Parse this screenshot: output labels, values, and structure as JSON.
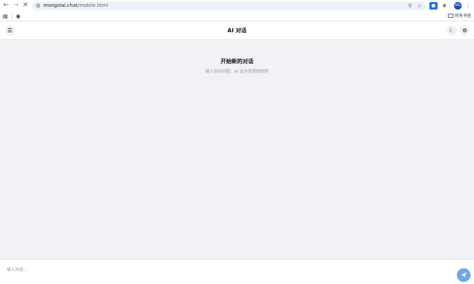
{
  "browser": {
    "url_host": "mongolai.chat",
    "url_path": "/mobile.html",
    "profile_initials": "MG",
    "bookmarks_all_label": "所有书签",
    "icons": [
      "back-icon",
      "forward-icon",
      "stop-icon",
      "site-info-icon",
      "zoom-icon",
      "bookmark-star-icon",
      "extensions-icon",
      "kebab-menu-icon",
      "apps-icon",
      "globe-icon",
      "folder-icon"
    ]
  },
  "header": {
    "title": "AI 对话",
    "icons": [
      "hamburger-menu-icon",
      "moon-icon",
      "gear-icon"
    ]
  },
  "main": {
    "empty_title": "开始新的对话",
    "empty_subtitle": "输入你的问题，AI 会为你提供回答"
  },
  "composer": {
    "placeholder": "输入消息...",
    "value": "",
    "send_icon": "send-icon"
  },
  "colors": {
    "accent": "#6ea8e8",
    "background": "#f2f2f6",
    "omnibox": "#edf2fa",
    "profile": "#174ea6"
  }
}
